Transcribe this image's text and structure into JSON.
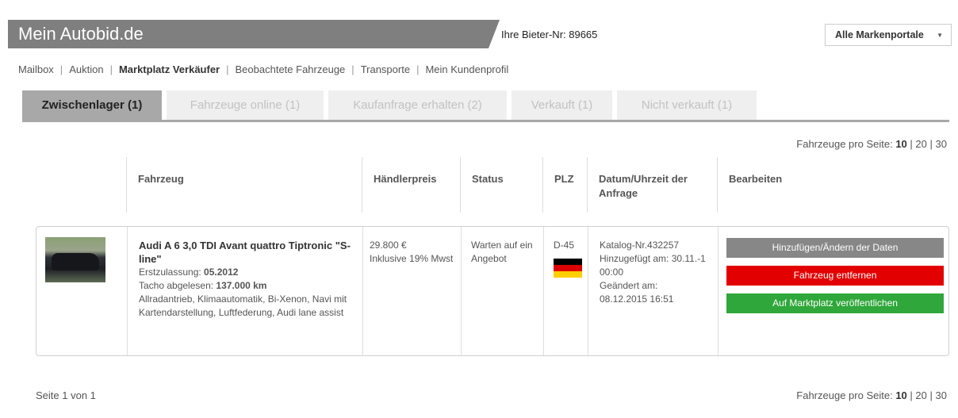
{
  "header": {
    "brand": "Mein Autobid.de",
    "bidder": "Ihre Bieter-Nr: 89665",
    "portal_select": "Alle Markenportale"
  },
  "nav": [
    "Mailbox",
    "Auktion",
    "Marktplatz Verkäufer",
    "Beobachtete Fahrzeuge",
    "Transporte",
    "Mein Kundenprofil"
  ],
  "tabs": [
    "Zwischenlager (1)",
    "Fahrzeuge online (1)",
    "Kaufanfrage erhalten (2)",
    "Verkauft (1)",
    "Nicht verkauft (1)"
  ],
  "perpage": {
    "label": "Fahrzeuge pro Seite:",
    "options": [
      "10",
      "20",
      "30"
    ],
    "sep": "|"
  },
  "columns": {
    "vehicle": "Fahrzeug",
    "price": "Händlerpreis",
    "status": "Status",
    "zip": "PLZ",
    "date": "Datum/Uhrzeit der Anfrage",
    "edit": "Bearbeiten"
  },
  "row": {
    "title": "Audi A 6 3,0 TDI Avant quattro Tiptronic \"S-line\"",
    "reg_label": "Erstzulassung:",
    "reg_value": "05.2012",
    "km_label": "Tacho abgelesen:",
    "km_value": "137.000 km",
    "features": "Allradantrieb, Klimaautomatik, Bi-Xenon, Navi mit Kartendarstellung, Luftfederung, Audi lane assist",
    "price": "29.800 €",
    "vat": "Inklusive 19% Mwst",
    "status": "Warten auf ein Angebot",
    "zip": "D-45",
    "catalog": "Katalog-Nr.432257",
    "added": "Hinzugefügt am: 30.11.-1 00:00",
    "changed_label": "Geändert am:",
    "changed": "08.12.2015 16:51",
    "buttons": {
      "edit": "Hinzufügen/Ändern der Daten",
      "remove": "Fahrzeug entfernen",
      "publish": "Auf Marktplatz veröffentlichen"
    }
  },
  "pageinfo": "Seite 1 von 1",
  "colors": {
    "header_bg": "#7f7f7f",
    "tab_active": "#a8a8a8",
    "red": "#e20000",
    "green": "#2fa73a",
    "gray_btn": "#878787"
  }
}
